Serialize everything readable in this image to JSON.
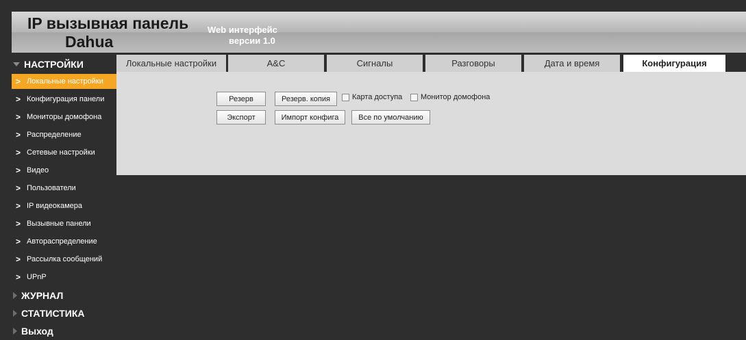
{
  "header": {
    "title_line1": "IP вызывная панель",
    "title_line2": "Dahua",
    "subtitle_line1": "Web интерфейс",
    "subtitle_line2": "версии 1.0"
  },
  "sidebar": {
    "settings_label": "НАСТРОЙКИ",
    "items": [
      {
        "label": "Локальные настройки"
      },
      {
        "label": "Конфигурация панели"
      },
      {
        "label": "Мониторы домофона"
      },
      {
        "label": "Распределение"
      },
      {
        "label": "Сетевые настройки"
      },
      {
        "label": "Видео"
      },
      {
        "label": "Пользователи"
      },
      {
        "label": "IP видеокамера"
      },
      {
        "label": "Вызывные панели"
      },
      {
        "label": "Автораспределение"
      },
      {
        "label": "Рассылка сообщений"
      },
      {
        "label": "UPnP"
      }
    ],
    "journal_label": "ЖУРНАЛ",
    "stats_label": "СТАТИСТИКА",
    "exit_label": "Выход"
  },
  "tabs": [
    {
      "label": "Локальные настройки"
    },
    {
      "label": "A&C"
    },
    {
      "label": "Сигналы"
    },
    {
      "label": "Разговоры"
    },
    {
      "label": "Дата и время"
    },
    {
      "label": "Конфигурация"
    }
  ],
  "content": {
    "backup_button": "Резерв",
    "backup_copy_button": "Резерв. копия",
    "access_card_label": "Карта доступа",
    "intercom_monitor_label": "Монитор домофона",
    "export_button": "Экспорт",
    "import_config_button": "Импорт конфига",
    "defaults_button": "Все по умолчанию"
  }
}
